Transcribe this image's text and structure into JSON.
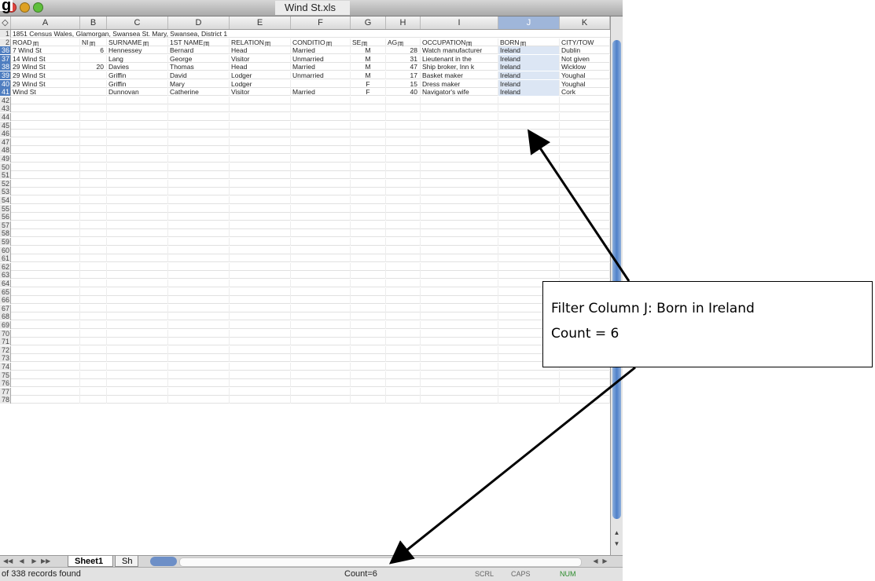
{
  "corner_label": "g",
  "window": {
    "title": "Wind St.xls"
  },
  "columns": [
    "A",
    "B",
    "C",
    "D",
    "E",
    "F",
    "G",
    "H",
    "I",
    "J",
    "K"
  ],
  "row1": {
    "number": "1",
    "text": "1851 Census Wales, Glamorgan, Swansea St. Mary, Swansea, District 1"
  },
  "headers": {
    "number": "2",
    "cells": [
      "ROAD",
      "NI",
      "SURNAME",
      "1ST NAME",
      "RELATION",
      "CONDITIO",
      "SE",
      "AG",
      "OCCUPATION",
      "BORN",
      "CITY/TOW"
    ]
  },
  "rows": [
    {
      "number": "36",
      "cells": [
        "7 Wind St",
        "6",
        "Hennessey",
        "Bernard",
        "Head",
        "Married",
        "M",
        "28",
        "Watch manufacturer",
        "Ireland",
        "Dublin"
      ]
    },
    {
      "number": "37",
      "cells": [
        "14 Wind St",
        "",
        "Lang",
        "George",
        "Visitor",
        "Unmarried",
        "M",
        "31",
        "Lieutenant in the",
        "Ireland",
        "Not given"
      ]
    },
    {
      "number": "38",
      "cells": [
        "29 Wind St",
        "20",
        "Davies",
        "Thomas",
        "Head",
        "Married",
        "M",
        "47",
        "Ship broker, Inn k",
        "Ireland",
        "Wicklow"
      ]
    },
    {
      "number": "39",
      "cells": [
        "29 Wind St",
        "",
        "Griffin",
        "David",
        "Lodger",
        "Unmarried",
        "M",
        "17",
        "Basket maker",
        "Ireland",
        "Youghal"
      ]
    },
    {
      "number": "40",
      "cells": [
        "29 Wind St",
        "",
        "Griffin",
        "Mary",
        "Lodger",
        "",
        "F",
        "15",
        "Dress maker",
        "Ireland",
        "Youghal"
      ]
    },
    {
      "number": "41",
      "cells": [
        "Wind St",
        "",
        "Dunnovan",
        "Catherine",
        "Visitor",
        "Married",
        "F",
        "40",
        "Navigator's wife",
        "Ireland",
        "Cork"
      ]
    }
  ],
  "empty_row_start": 41,
  "empty_row_end": 78,
  "tabs": {
    "sheet1": "Sheet1",
    "sheet2": "Sh"
  },
  "status": {
    "records": "of 338 records found",
    "count": "Count=6",
    "scrl": "SCRL",
    "caps": "CAPS",
    "num": "NUM"
  },
  "annotation": {
    "line1": "Filter Column J: Born in Ireland",
    "line2": "Count = 6"
  },
  "colors": {
    "selection": "#4f7ec0",
    "column_j_highlight": "#dce6f4"
  }
}
